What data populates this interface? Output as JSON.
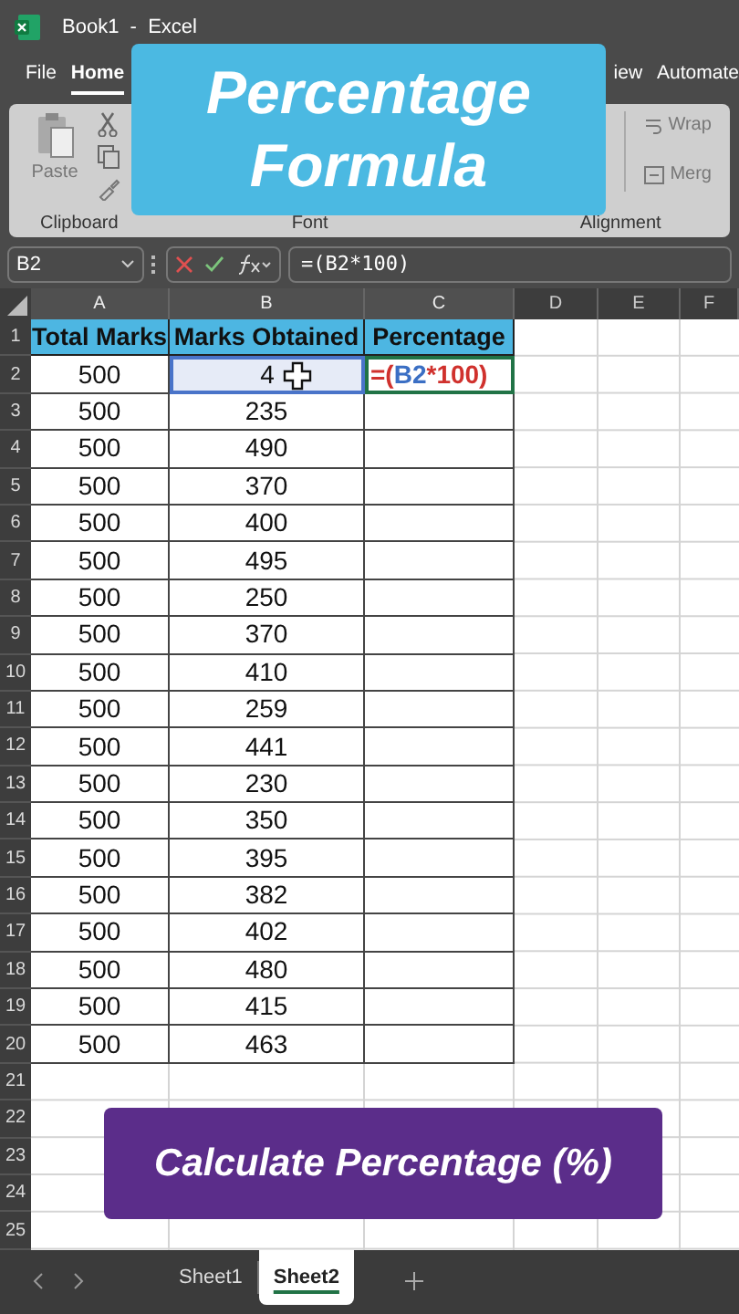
{
  "window": {
    "title": "Book1  -  Excel"
  },
  "menu_tabs": [
    {
      "label": "File",
      "selected": false
    },
    {
      "label": "Home",
      "selected": true
    },
    {
      "label": "iew",
      "selected": false
    },
    {
      "label": "Automate",
      "selected": false
    }
  ],
  "ribbon": {
    "paste_label": "Paste",
    "wrap_label": "Wrap",
    "merge_label": "Merg",
    "groups": [
      "Clipboard",
      "Font",
      "Alignment"
    ]
  },
  "formula_bar": {
    "name_box": "B2",
    "formula": "=(B2*100)"
  },
  "columns": [
    "A",
    "B",
    "C",
    "D",
    "E",
    "F"
  ],
  "rows": [
    {
      "number": "1",
      "kind": "header",
      "cells": [
        "Total Marks",
        "Marks Obtained",
        "Percentage"
      ]
    },
    {
      "number": "2",
      "kind": "data",
      "cells": [
        {
          "text": "500",
          "selected": false
        },
        {
          "text": "4",
          "selected": true
        },
        {
          "selected": false,
          "editing": true,
          "parts": [
            {
              "text": "=(",
              "color": "#d0312d"
            },
            {
              "text": "B2",
              "color": "#3b6fc4"
            },
            {
              "text": "*100)",
              "color": "#d0312d"
            }
          ]
        }
      ]
    },
    {
      "number": "3",
      "kind": "data",
      "cells": [
        "500",
        "235"
      ]
    },
    {
      "number": "4",
      "kind": "data",
      "cells": [
        "500",
        "490"
      ]
    },
    {
      "number": "5",
      "kind": "data",
      "cells": [
        "500",
        "370"
      ]
    },
    {
      "number": "6",
      "kind": "data",
      "cells": [
        "500",
        "400"
      ]
    },
    {
      "number": "7",
      "kind": "data",
      "cells": [
        "500",
        "495"
      ]
    },
    {
      "number": "8",
      "kind": "data",
      "cells": [
        "500",
        "250"
      ]
    },
    {
      "number": "9",
      "kind": "data",
      "cells": [
        "500",
        "370"
      ]
    },
    {
      "number": "10",
      "kind": "data",
      "cells": [
        "500",
        "410"
      ]
    },
    {
      "number": "11",
      "kind": "data",
      "cells": [
        "500",
        "259"
      ]
    },
    {
      "number": "12",
      "kind": "data",
      "cells": [
        "500",
        "441"
      ]
    },
    {
      "number": "13",
      "kind": "data",
      "cells": [
        "500",
        "230"
      ]
    },
    {
      "number": "14",
      "kind": "data",
      "cells": [
        "500",
        "350"
      ]
    },
    {
      "number": "15",
      "kind": "data",
      "cells": [
        "500",
        "395"
      ]
    },
    {
      "number": "16",
      "kind": "data",
      "cells": [
        "500",
        "382"
      ]
    },
    {
      "number": "17",
      "kind": "data",
      "cells": [
        "500",
        "402"
      ]
    },
    {
      "number": "18",
      "kind": "data",
      "cells": [
        "500",
        "480"
      ]
    },
    {
      "number": "19",
      "kind": "data",
      "cells": [
        "500",
        "415"
      ]
    },
    {
      "number": "20",
      "kind": "data",
      "cells": [
        "500",
        "463"
      ]
    },
    {
      "number": "21",
      "kind": "data",
      "cells": []
    },
    {
      "number": "22",
      "kind": "data",
      "cells": []
    },
    {
      "number": "23",
      "kind": "data",
      "cells": []
    },
    {
      "number": "24",
      "kind": "data",
      "cells": []
    },
    {
      "number": "25",
      "kind": "data",
      "cells": []
    }
  ],
  "sheet_tabs": [
    {
      "label": "Sheet1",
      "selected": false
    },
    {
      "label": "Sheet2",
      "selected": true
    }
  ],
  "overlays": [
    {
      "kind": "title",
      "lines": [
        "Percentage",
        "Formula"
      ]
    },
    {
      "kind": "caption",
      "lines": [
        "Calculate Percentage (%)"
      ]
    }
  ]
}
